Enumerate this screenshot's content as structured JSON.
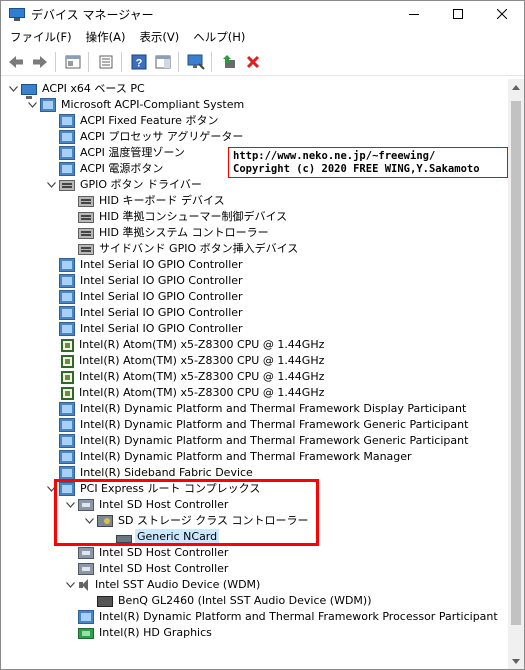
{
  "window": {
    "title": "デバイス マネージャー",
    "minimize_glyph": "minimize",
    "maximize_glyph": "maximize",
    "close_glyph": "close"
  },
  "menu": [
    {
      "label": "ファイル(F)"
    },
    {
      "label": "操作(A)"
    },
    {
      "label": "表示(V)"
    },
    {
      "label": "ヘルプ(H)"
    }
  ],
  "toolbar": {
    "icons": [
      "back-arrow-icon",
      "forward-arrow-icon",
      "properties-icon",
      "update-view-icon",
      "help-icon",
      "action-pane-icon",
      "scan-hardware-icon",
      "add-driver-icon",
      "uninstall-icon"
    ],
    "accent_red": "#e02020",
    "accent_green": "#2a9d3a"
  },
  "tree": [
    {
      "id": "root",
      "label": "ACPI x64 ベース PC",
      "depth": 0,
      "expanded": true,
      "icon": "computer-icon"
    },
    {
      "id": "acpi-system",
      "label": "Microsoft ACPI-Compliant System",
      "depth": 1,
      "expanded": true,
      "icon": "system-device-icon"
    },
    {
      "id": "acpi-fixed",
      "label": "ACPI Fixed Feature ボタン",
      "depth": 2,
      "icon": "system-device-icon"
    },
    {
      "id": "acpi-proc",
      "label": "ACPI プロセッサ アグリゲーター",
      "depth": 2,
      "icon": "system-device-icon"
    },
    {
      "id": "acpi-thermal",
      "label": "ACPI 温度管理ゾーン",
      "depth": 2,
      "icon": "system-device-icon"
    },
    {
      "id": "acpi-power",
      "label": "ACPI 電源ボタン",
      "depth": 2,
      "icon": "system-device-icon"
    },
    {
      "id": "gpio-driver",
      "label": "GPIO ボタン ドライバー",
      "depth": 2,
      "expanded": true,
      "icon": "hid-icon"
    },
    {
      "id": "hid-kbd",
      "label": "HID キーボード デバイス",
      "depth": 3,
      "icon": "hid-icon"
    },
    {
      "id": "hid-consumer",
      "label": "HID 準拠コンシューマー制御デバイス",
      "depth": 3,
      "icon": "hid-icon"
    },
    {
      "id": "hid-system",
      "label": "HID 準拠システム コントローラー",
      "depth": 3,
      "icon": "hid-icon"
    },
    {
      "id": "sideband-gpio",
      "label": "サイドバンド GPIO ボタン挿入デバイス",
      "depth": 3,
      "icon": "hid-icon"
    },
    {
      "id": "serial-gpio-1",
      "label": "Intel Serial IO GPIO Controller",
      "depth": 2,
      "icon": "system-device-icon"
    },
    {
      "id": "serial-gpio-2",
      "label": "Intel Serial IO GPIO Controller",
      "depth": 2,
      "icon": "system-device-icon"
    },
    {
      "id": "serial-gpio-3",
      "label": "Intel Serial IO GPIO Controller",
      "depth": 2,
      "icon": "system-device-icon"
    },
    {
      "id": "serial-gpio-4",
      "label": "Intel Serial IO GPIO Controller",
      "depth": 2,
      "icon": "system-device-icon"
    },
    {
      "id": "serial-gpio-5",
      "label": "Intel Serial IO GPIO Controller",
      "depth": 2,
      "icon": "system-device-icon"
    },
    {
      "id": "cpu-1",
      "label": "Intel(R) Atom(TM) x5-Z8300  CPU @ 1.44GHz",
      "depth": 2,
      "icon": "cpu-icon"
    },
    {
      "id": "cpu-2",
      "label": "Intel(R) Atom(TM) x5-Z8300  CPU @ 1.44GHz",
      "depth": 2,
      "icon": "cpu-icon"
    },
    {
      "id": "cpu-3",
      "label": "Intel(R) Atom(TM) x5-Z8300  CPU @ 1.44GHz",
      "depth": 2,
      "icon": "cpu-icon"
    },
    {
      "id": "cpu-4",
      "label": "Intel(R) Atom(TM) x5-Z8300  CPU @ 1.44GHz",
      "depth": 2,
      "icon": "cpu-icon"
    },
    {
      "id": "dptf-display",
      "label": "Intel(R) Dynamic Platform and Thermal Framework Display Participant",
      "depth": 2,
      "icon": "system-device-icon"
    },
    {
      "id": "dptf-generic-1",
      "label": "Intel(R) Dynamic Platform and Thermal Framework Generic Participant",
      "depth": 2,
      "icon": "system-device-icon"
    },
    {
      "id": "dptf-generic-2",
      "label": "Intel(R) Dynamic Platform and Thermal Framework Generic Participant",
      "depth": 2,
      "icon": "system-device-icon"
    },
    {
      "id": "dptf-manager",
      "label": "Intel(R) Dynamic Platform and Thermal Framework Manager",
      "depth": 2,
      "icon": "system-device-icon"
    },
    {
      "id": "sideband-fabric",
      "label": "Intel(R) Sideband Fabric Device",
      "depth": 2,
      "icon": "system-device-icon"
    },
    {
      "id": "pci-root",
      "label": "PCI Express ルート コンプレックス",
      "depth": 2,
      "expanded": true,
      "icon": "system-device-icon"
    },
    {
      "id": "sd-host-1",
      "label": "Intel SD Host Controller",
      "depth": 3,
      "expanded": true,
      "icon": "sd-host-icon"
    },
    {
      "id": "sd-storage",
      "label": "SD ストレージ クラス コントローラー",
      "depth": 4,
      "expanded": true,
      "icon": "storage-controller-icon"
    },
    {
      "id": "generic-ncard",
      "label": "Generic NCard",
      "depth": 5,
      "selected": true,
      "icon": "sd-card-icon"
    },
    {
      "id": "sd-host-2",
      "label": "Intel SD Host Controller",
      "depth": 3,
      "icon": "sd-host-icon"
    },
    {
      "id": "sd-host-3",
      "label": "Intel SD Host Controller",
      "depth": 3,
      "icon": "sd-host-icon"
    },
    {
      "id": "sst-audio",
      "label": "Intel SST Audio Device (WDM)",
      "depth": 3,
      "expanded": true,
      "icon": "speaker-icon"
    },
    {
      "id": "benq-audio",
      "label": "BenQ GL2460 (Intel SST Audio Device (WDM))",
      "depth": 4,
      "icon": "audio-device-icon"
    },
    {
      "id": "dptf-processor",
      "label": "Intel(R) Dynamic Platform and Thermal Framework Processor Participant",
      "depth": 3,
      "icon": "system-device-icon"
    },
    {
      "id": "hd-graphics",
      "label": "Intel(R) HD Graphics",
      "depth": 3,
      "icon": "display-adapter-icon"
    }
  ],
  "annotation": {
    "line1": "http://www.neko.ne.jp/~freewing/",
    "line2": "Copyright (c) 2020 FREE WING,Y.Sakamoto",
    "border_color": "#ff0000"
  },
  "colors": {
    "selection": "#cce8ff",
    "highlight_red": "#ff0000"
  }
}
